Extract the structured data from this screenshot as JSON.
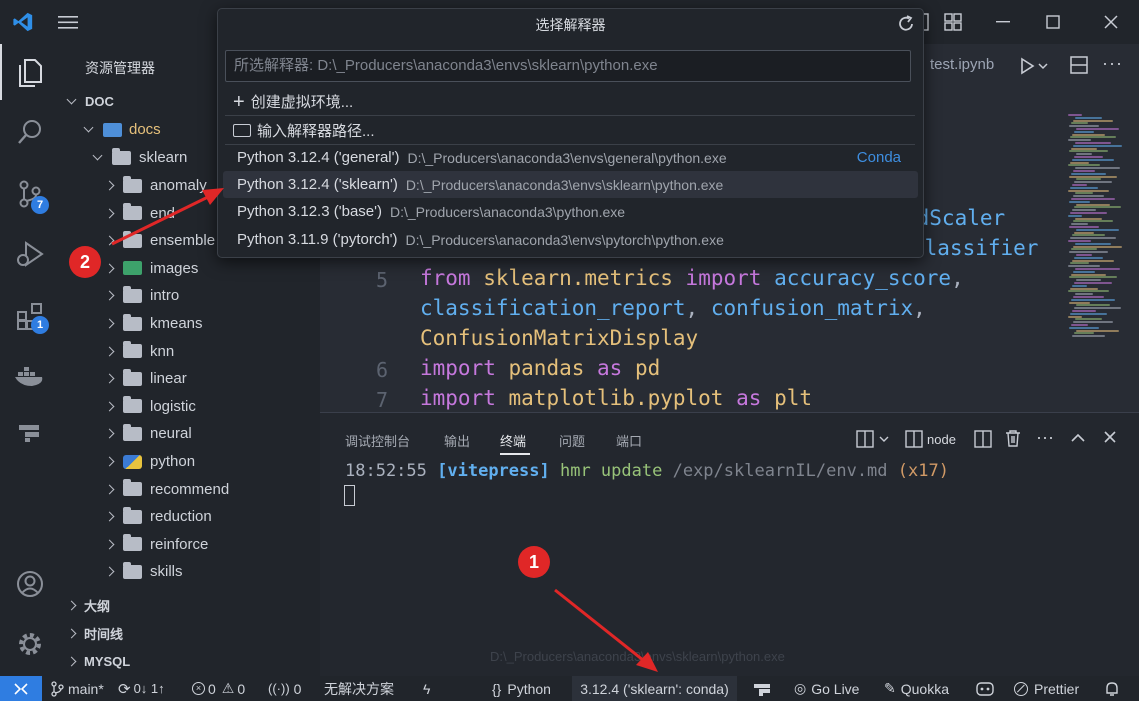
{
  "titlebar": {
    "window_controls": [
      "minimize-icon",
      "maximize-icon",
      "close-icon"
    ]
  },
  "quickpick": {
    "title": "选择解释器",
    "input_value": "所选解释器: D:\\_Producers\\anaconda3\\envs\\sklearn\\python.exe",
    "actions": [
      "创建虚拟环境...",
      "输入解释器路径..."
    ],
    "interpreters": [
      {
        "name": "Python 3.12.4 ('general')",
        "path": "D:\\_Producers\\anaconda3\\envs\\general\\python.exe",
        "tag": "Conda"
      },
      {
        "name": "Python 3.12.4 ('sklearn')",
        "path": "D:\\_Producers\\anaconda3\\envs\\sklearn\\python.exe",
        "tag": ""
      },
      {
        "name": "Python 3.12.3 ('base')",
        "path": "D:\\_Producers\\anaconda3\\python.exe",
        "tag": ""
      },
      {
        "name": "Python 3.11.9 ('pytorch')",
        "path": "D:\\_Producers\\anaconda3\\envs\\pytorch\\python.exe",
        "tag": ""
      }
    ]
  },
  "activity": {
    "badges": {
      "scm": "7",
      "extensions": "1"
    }
  },
  "sidebar": {
    "title": "资源管理器",
    "root": "DOC",
    "docs": "docs",
    "sklearn": "sklearn",
    "folders": [
      "anomaly",
      "end",
      "ensemble",
      "images",
      "intro",
      "kmeans",
      "knn",
      "linear",
      "logistic",
      "neural",
      "python",
      "recommend",
      "reduction",
      "reinforce",
      "skills"
    ],
    "sections": [
      "大纲",
      "时间线",
      "MYSQL"
    ]
  },
  "editor": {
    "tab": "test.ipynb",
    "line_numbers": [
      "5",
      "6",
      "7"
    ],
    "frag1": "rdScaler",
    "frag2": "Classifier",
    "line5_kw1": "from",
    "line5_mod": "sklearn.metrics",
    "line5_kw2": "import",
    "line5_fn": "accuracy_score",
    "line5_comma": ",",
    "line5b_fn1": "classification_report",
    "line5b_c1": ",",
    "line5b_fn2": "confusion_matrix",
    "line5b_c2": ",",
    "line5c_id": "ConfusionMatrixDisplay",
    "line6_kw1": "import",
    "line6_mod": "pandas",
    "line6_kw2": "as",
    "line6_alias": "pd",
    "line7_kw1": "import",
    "line7_mod": "matplotlib.pyplot",
    "line7_kw2": "as",
    "line7_alias": "plt"
  },
  "panel": {
    "tabs": [
      "调试控制台",
      "输出",
      "终端",
      "问题",
      "端口"
    ],
    "active_tab": "终端",
    "shell": "node",
    "terminal": {
      "time": "18:52:55",
      "tag": "[vitepress]",
      "cmd": "hmr update",
      "path": "/exp/sklearnIL/env.md",
      "count": "(x17)"
    },
    "faded_path": "D:\\_Producers\\anaconda3\\envs\\sklearn\\python.exe"
  },
  "status": {
    "branch": "main*",
    "sync": "0↓ 1↑",
    "errors": "0",
    "warnings": "0",
    "ports": "0",
    "solution": "无解决方案",
    "language": "Python",
    "interpreter": "3.12.4 ('sklearn': conda)",
    "golive": "Go Live",
    "quokka": "Quokka",
    "prettier": "Prettier"
  },
  "callouts": [
    "1",
    "2"
  ],
  "colors": {
    "accent": "#2f7de1",
    "callout": "#e02727",
    "bg": "#282c34"
  }
}
